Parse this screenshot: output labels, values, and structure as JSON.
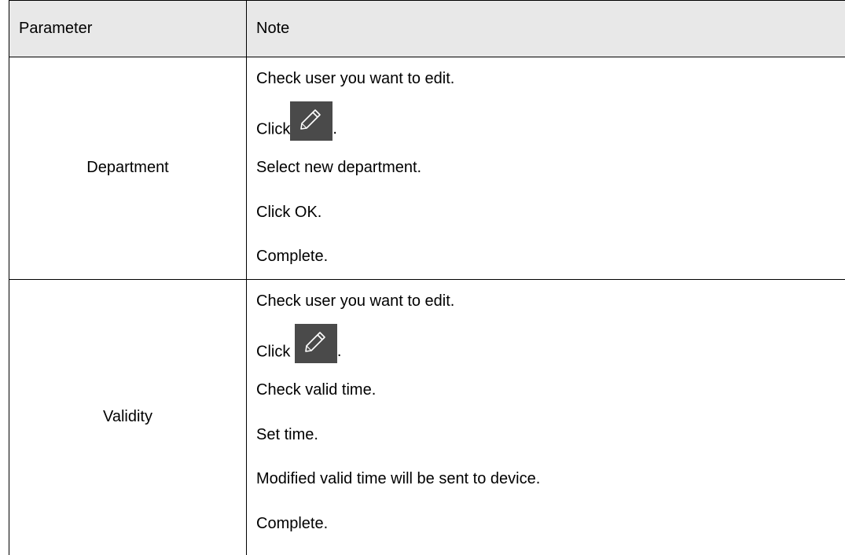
{
  "table": {
    "headers": {
      "parameter": "Parameter",
      "note": "Note"
    },
    "rows": [
      {
        "parameter": "Department",
        "steps": {
          "s1": "Check user you want to edit.",
          "s2_prefix": "Click",
          "s2_suffix": ".",
          "s3": "Select new department.",
          "s4": "Click OK.",
          "s5": "Complete."
        }
      },
      {
        "parameter": "Validity",
        "steps": {
          "s1": "Check user you want to edit.",
          "s2_prefix": "Click ",
          "s2_suffix": ".",
          "s3": "Check valid time.",
          "s4": "Set time.",
          "s5": "Modified valid time will be sent to device.",
          "s6": "Complete."
        }
      }
    ]
  },
  "icons": {
    "edit": "pencil-icon",
    "edit_bg": "#4a4a4a",
    "edit_fg": "#ffffff"
  },
  "colors": {
    "header_bg": "#e8e8e8",
    "border": "#000000"
  }
}
